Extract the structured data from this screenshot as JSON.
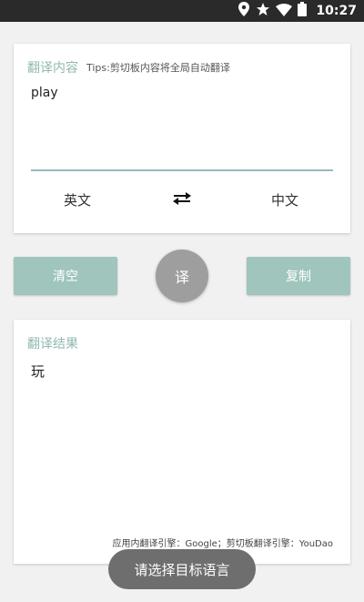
{
  "status_bar": {
    "time": "10:27",
    "icons": [
      "location-icon",
      "star-icon",
      "wifi-icon",
      "battery-icon"
    ]
  },
  "input_card": {
    "title": "翻译内容",
    "tips": "Tips:剪切板内容将全局自动翻译",
    "input_text": "play",
    "source_lang": "英文",
    "target_lang": "中文",
    "swap_icon": "swap-arrows-icon"
  },
  "actions": {
    "clear_label": "清空",
    "translate_label": "译",
    "copy_label": "复制"
  },
  "result_card": {
    "title": "翻译结果",
    "result_text": "玩",
    "engine_info": "应用内翻译引擎：Google；剪切板翻译引擎：YouDao"
  },
  "toast": {
    "message": "请选择目标语言"
  },
  "colors": {
    "accent": "#8fb9b0",
    "button": "#9fc5bd",
    "translate_button": "#9e9e9e",
    "underline": "#9ab8c0",
    "status_bar": "#2a2a2a",
    "toast": "#6e6e6e"
  }
}
